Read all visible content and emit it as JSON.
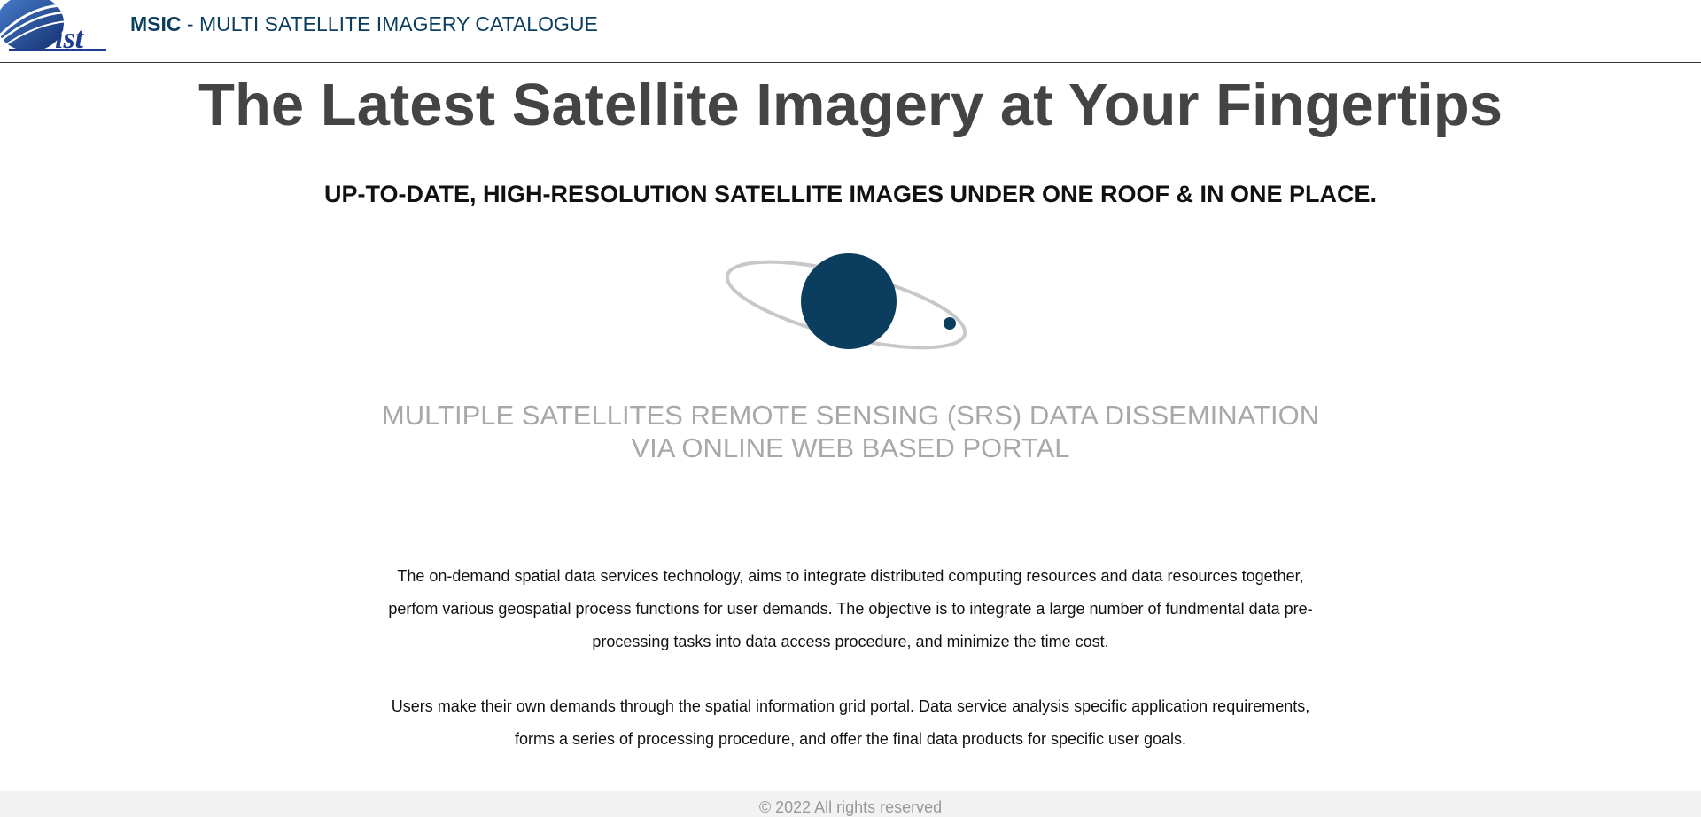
{
  "header": {
    "brand_strong": "MSIC",
    "brand_rest": " - MULTI SATELLITE IMAGERY CATALOGUE",
    "logo_text": "ist",
    "colors": {
      "brand": "#0b3d5e",
      "logo_blue": "#1e3d8f"
    }
  },
  "hero": {
    "headline": "The Latest Satellite Imagery at Your Fingertips",
    "subheadline": "UP-TO-DATE, HIGH-RESOLUTION SATELLITE IMAGES UNDER ONE ROOF & IN ONE PLACE.",
    "illustration_icon": "planet-orbit-icon",
    "tagline_line1": "MULTIPLE SATELLITES REMOTE SENSING (SRS) DATA DISSEMINATION",
    "tagline_line2": "VIA ONLINE WEB BASED PORTAL"
  },
  "content": {
    "paragraph1_line1": "The on-demand spatial data services technology, aims to integrate distributed computing resources and data resources together,",
    "paragraph1_line2": "perfom various geospatial process functions for user demands. The objective is to integrate a large number of fundmental data pre-",
    "paragraph1_line3": "processing tasks into data access procedure, and minimize the time cost.",
    "paragraph2_line1": "Users make their own demands through the spatial information grid portal. Data service analysis specific application requirements,",
    "paragraph2_line2": "forms a series of processing procedure, and offer the final data products for specific user goals."
  },
  "footer": {
    "copyright": "© 2022 All rights reserved"
  }
}
